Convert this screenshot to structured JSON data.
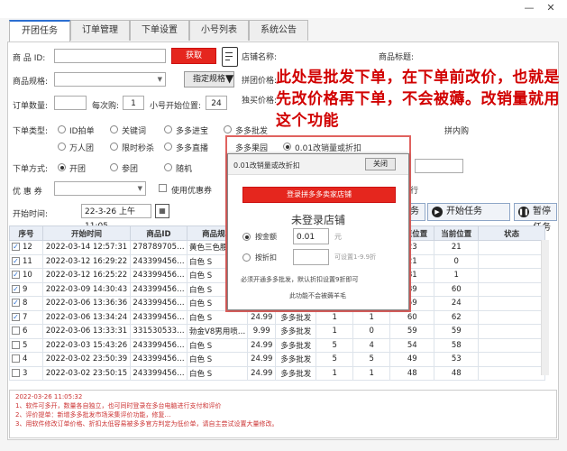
{
  "tabs": [
    "开团任务",
    "订单管理",
    "下单设置",
    "小号列表",
    "系统公告"
  ],
  "form": {
    "shop_id_label": "商 品 ID:",
    "shop_id_value": "",
    "fetch_button": "获取",
    "shop_name_label": "店铺名称:",
    "product_title_label": "商品标题:",
    "spec_label": "商品规格:",
    "spec_value": "",
    "spec_button": "指定规格",
    "group_price_label": "拼团价格:",
    "single_price_label": "独买价格:",
    "order_qty_label": "订单数量:",
    "order_qty_value": "",
    "per_buy_label": "每次购:",
    "per_buy_value": "1",
    "start_pos_label": "小号开始位置:",
    "start_pos_value": "24",
    "order_type_label": "下单类型:",
    "order_type_options": [
      "ID拍单",
      "关键词",
      "多多进宝",
      "多多批发",
      "万人团",
      "限时秒杀",
      "多多直播",
      "多多果园",
      "0.01改销量或折扣"
    ],
    "order_type_extra": "拼内购",
    "order_mode_label": "下单方式:",
    "order_mode_options": [
      "开团",
      "参团",
      "随机"
    ],
    "coupon_label": "优 惠 券",
    "coupon_value": "",
    "use_coupon_label": "使用优惠券",
    "start_time_label": "开始时间:",
    "start_time_value": "22-3-26 上午11:05",
    "exec_label": "行"
  },
  "buttons": {
    "tasks_partial": "务",
    "start": "开始任务",
    "pause": "暂停任务"
  },
  "overlay_text": "此处是批发下单，在下单前改价，也就是先改价格再下单，不会被薅。改销量就用这个功能",
  "dialog": {
    "title": "0.01改销量或改折扣",
    "close": "关闭",
    "login_button": "登录拼多多卖家店铺",
    "status": "未登录店铺",
    "by_amount_label": "按金额",
    "amount_value": "0.01",
    "amount_unit": "元",
    "by_discount_label": "按折扣",
    "discount_hint": "可设置1-9.9折",
    "note1": "必须开通多多批发，默认折扣设置9折即可",
    "note2": "此功能不会被薅羊毛"
  },
  "table": {
    "headers": [
      "序号",
      "开始时间",
      "商品ID",
      "商品规格",
      "",
      "",
      "",
      "",
      "结束位置",
      "当前位置",
      "状态"
    ],
    "rows": [
      {
        "checked": true,
        "no": "12",
        "time": "2022-03-14 12:57:31",
        "id": "278789705…",
        "spec": "黄色三色腰带…",
        "price": "",
        "type": "",
        "a": "",
        "b": "",
        "end": "23",
        "cur": "21",
        "status": ""
      },
      {
        "checked": true,
        "no": "11",
        "time": "2022-03-12 16:29:22",
        "id": "243399456…",
        "spec": "白色 S",
        "price": "",
        "type": "",
        "a": "",
        "b": "",
        "end": "21",
        "cur": "0",
        "status": ""
      },
      {
        "checked": true,
        "no": "10",
        "time": "2022-03-12 16:25:22",
        "id": "243399456…",
        "spec": "白色 S",
        "price": "",
        "type": "",
        "a": "",
        "b": "",
        "end": "81",
        "cur": "1",
        "status": ""
      },
      {
        "checked": true,
        "no": "9",
        "time": "2022-03-09 14:30:43",
        "id": "243399456…",
        "spec": "白色 S",
        "price": "",
        "type": "",
        "a": "",
        "b": "",
        "end": "89",
        "cur": "60",
        "status": ""
      },
      {
        "checked": true,
        "no": "8",
        "time": "2022-03-06 13:36:36",
        "id": "243399456…",
        "spec": "白色 S",
        "price": "",
        "type": "",
        "a": "",
        "b": "",
        "end": "59",
        "cur": "24",
        "status": ""
      },
      {
        "checked": true,
        "no": "7",
        "time": "2022-03-06 13:34:24",
        "id": "243399456…",
        "spec": "白色 S",
        "price": "24.99",
        "type": "多多批发",
        "a": "1",
        "b": "1",
        "end": "60",
        "cur": "62",
        "status": ""
      },
      {
        "checked": false,
        "no": "6",
        "time": "2022-03-06 13:33:31",
        "id": "331530533…",
        "spec": "勃金V8男用喷…",
        "price": "9.99",
        "type": "多多批发",
        "a": "1",
        "b": "0",
        "end": "59",
        "cur": "59",
        "status": ""
      },
      {
        "checked": false,
        "no": "5",
        "time": "2022-03-03 15:43:26",
        "id": "243399456…",
        "spec": "白色 S",
        "price": "24.99",
        "type": "多多批发",
        "a": "5",
        "b": "4",
        "end": "54",
        "cur": "58",
        "status": ""
      },
      {
        "checked": false,
        "no": "4",
        "time": "2022-03-02 23:50:39",
        "id": "243399456…",
        "spec": "白色 S",
        "price": "24.99",
        "type": "多多批发",
        "a": "5",
        "b": "5",
        "end": "49",
        "cur": "53",
        "status": ""
      },
      {
        "checked": false,
        "no": "3",
        "time": "2022-03-02 23:50:15",
        "id": "243399456…",
        "spec": "白色 S",
        "price": "24.99",
        "type": "多多批发",
        "a": "1",
        "b": "1",
        "end": "48",
        "cur": "48",
        "status": ""
      }
    ]
  },
  "log": [
    "2022-03-26 11:05:32",
    "1、软件可多开，数量各自独立，也可同时登录在多台电脑进行支付和评价",
    "2、评价提单：新增多多批发市场采集评价功能，修复…",
    "3、用软件修改订单价格、折扣太低容易被多多官方判定为低价单，请自主尝试设置大量修改。"
  ],
  "icons": [
    "doc-icon",
    "play-icon",
    "pause-icon",
    "calendar-icon",
    "close-icon",
    "minimize-icon"
  ],
  "colors": {
    "red": "#e5261e",
    "overlay_red": "#d10000",
    "accent": "#2c6fd1"
  }
}
